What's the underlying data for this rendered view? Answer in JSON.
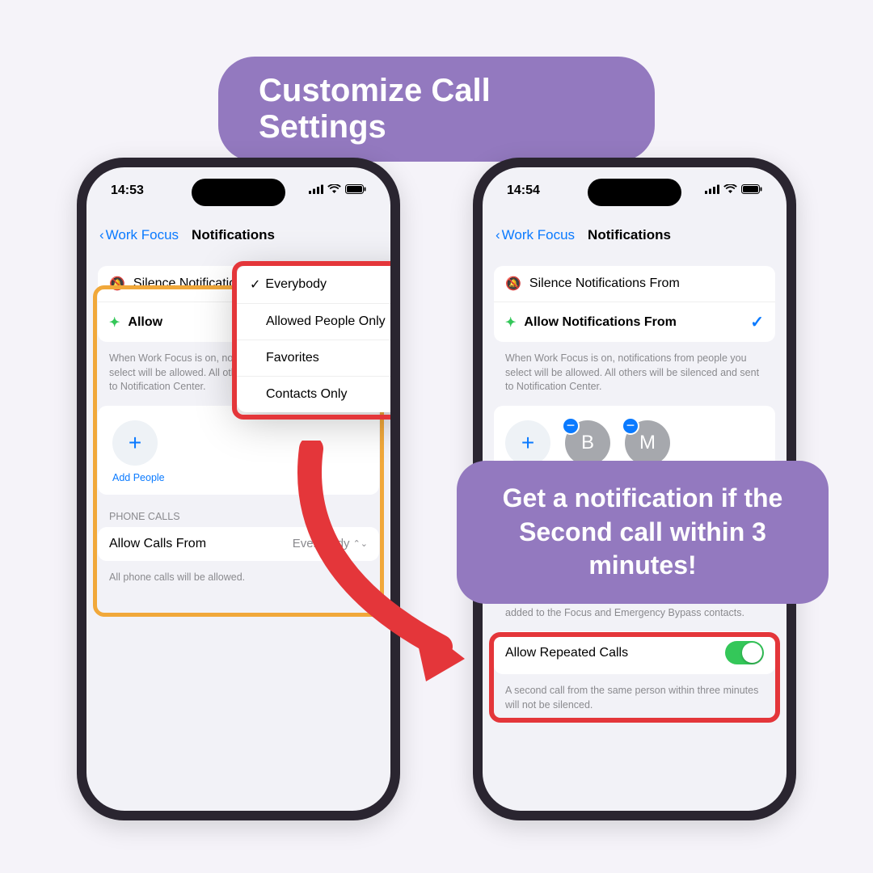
{
  "banner": "Customize Call Settings",
  "callout": "Get a notification if the Second call within 3 minutes!",
  "phone1": {
    "time": "14:53",
    "back": "Work Focus",
    "title": "Notifications",
    "silence_label": "Silence Notifications From",
    "allow_label": "Allow",
    "helper": "When Work Focus is on, notifications from people you select will be allowed. All others will be silenced and sent to Notification Center.",
    "add_people": "Add People",
    "phone_calls_header": "PHONE CALLS",
    "allow_calls": "Allow Calls From",
    "allow_calls_val": "Everybody",
    "allow_calls_helper": "All phone calls will be allowed."
  },
  "phone2": {
    "time": "14:54",
    "back": "Work Focus",
    "title": "Notifications",
    "silence_label": "Silence Notifications From",
    "allow_label": "Allow Notifications From",
    "helper": "When Work Focus is on, notifications from people you select will be allowed. All others will be silenced and sent to Notification Center.",
    "avatars": [
      "B",
      "M"
    ],
    "bypass_helper": "added to the Focus and Emergency Bypass contacts.",
    "repeated_label": "Allow Repeated Calls",
    "repeated_helper": "A second call from the same person within three minutes will not be silenced."
  },
  "popup": {
    "items": [
      "Everybody",
      "Allowed People Only",
      "Favorites",
      "Contacts Only"
    ],
    "selected": 0
  }
}
